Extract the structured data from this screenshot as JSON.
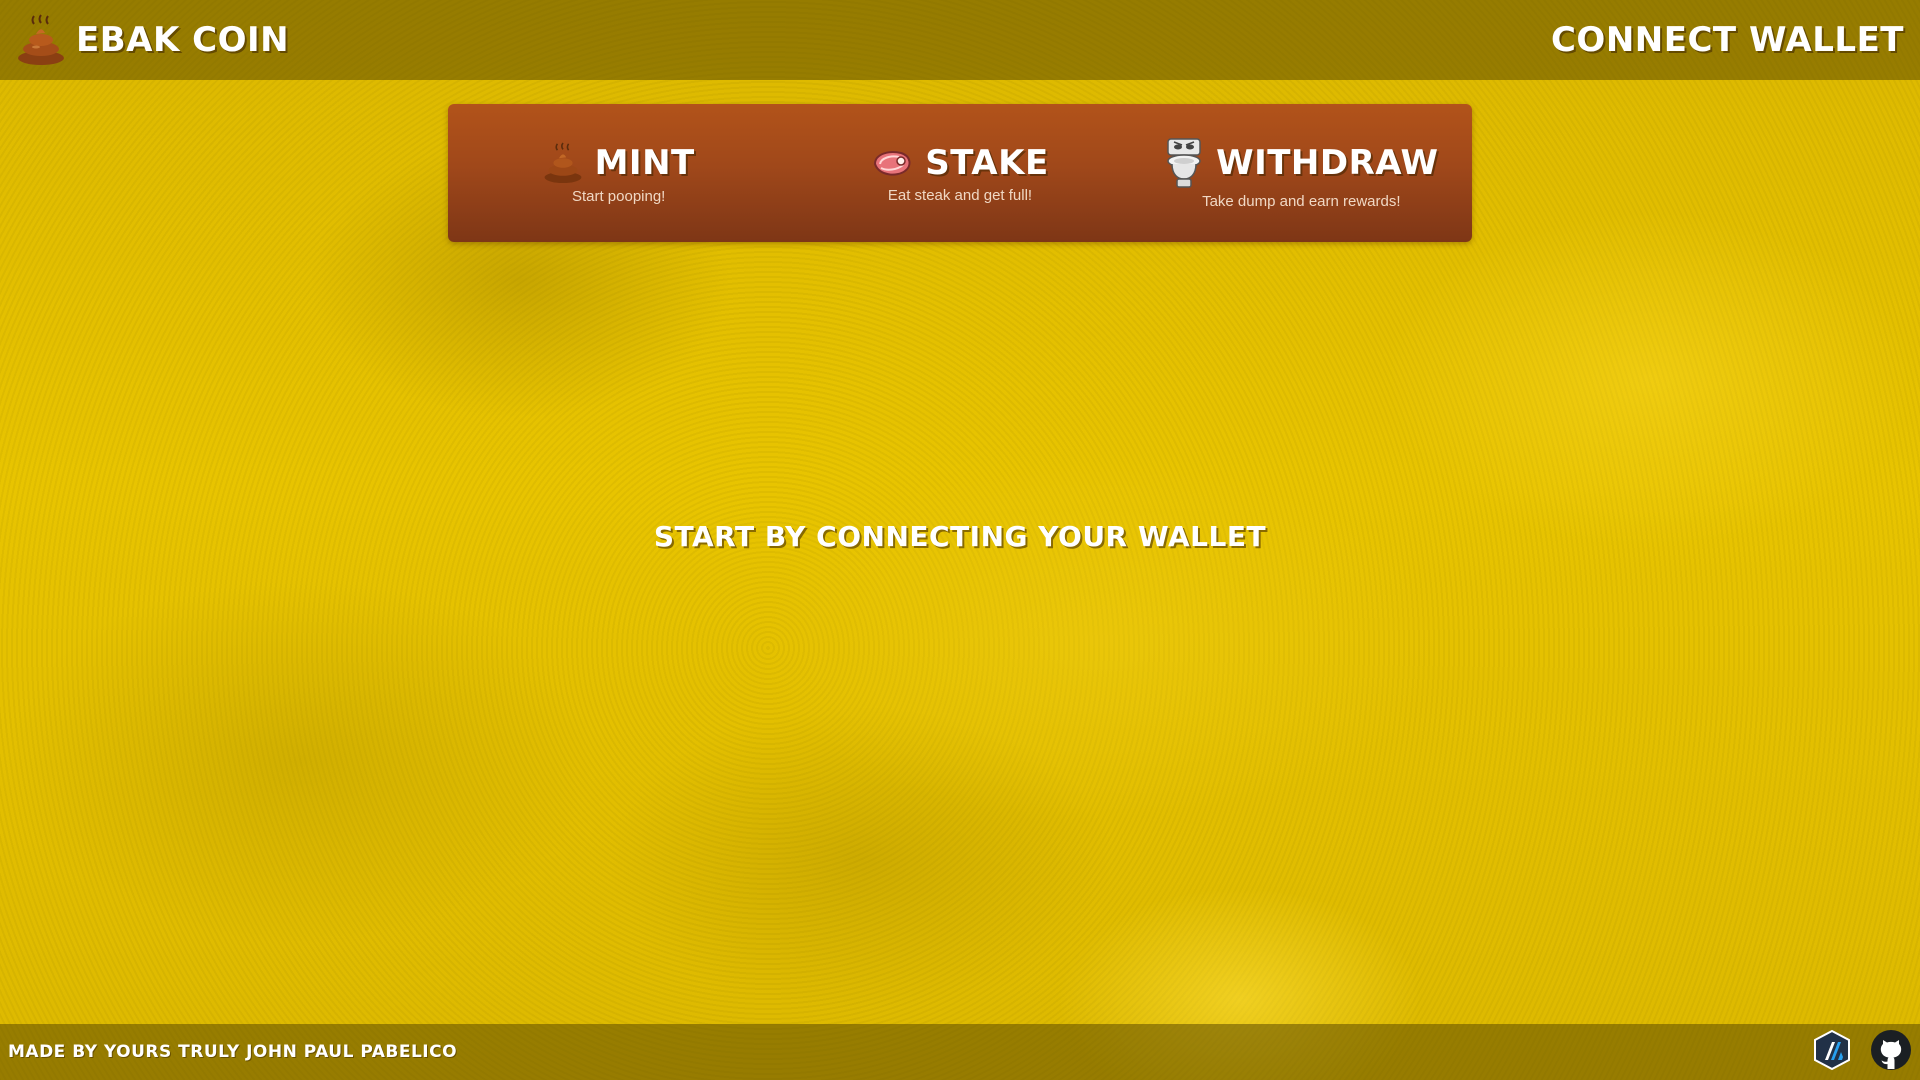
{
  "header": {
    "brand_title": "EBAK COIN",
    "logo_icon": "poop-icon",
    "connect_label": "CONNECT WALLET"
  },
  "nav": {
    "items": [
      {
        "title": "MINT",
        "subtitle": "Start pooping!",
        "icon": "poop-icon"
      },
      {
        "title": "STAKE",
        "subtitle": "Eat steak and get full!",
        "icon": "steak-icon"
      },
      {
        "title": "WITHDRAW",
        "subtitle": "Take dump and earn rewards!",
        "icon": "toilet-icon"
      }
    ]
  },
  "main": {
    "message": "START BY CONNECTING YOUR WALLET"
  },
  "footer": {
    "credit": "MADE BY YOURS TRULY JOHN PAUL PABELICO",
    "icons": [
      "arbitrum-icon",
      "github-icon"
    ]
  },
  "colors": {
    "background": "#e3c000",
    "bar_overlay": "#5c4a00",
    "panel": "#a0481a",
    "text": "#ffffff"
  }
}
